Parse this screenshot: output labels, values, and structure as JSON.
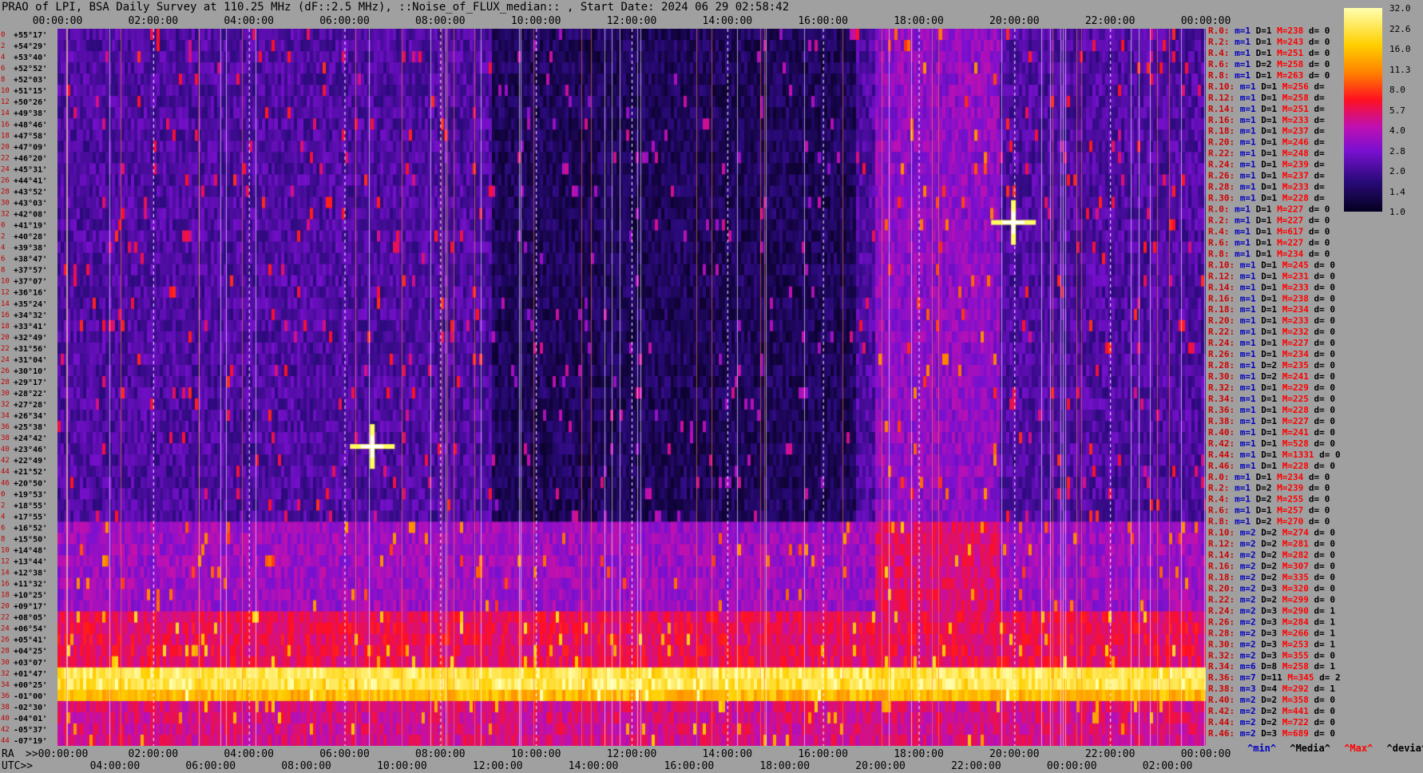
{
  "chart_data": {
    "type": "heatmap",
    "title": "PRAO of LPI, BSA Daily Survey at 110.25 MHz (dF::2.5 MHz), ::Noise_of_FLUX_median:: , Start Date: 2024 06 29 02:58:42",
    "x_top_ticks": [
      "00:00:00",
      "02:00:00",
      "04:00:00",
      "06:00:00",
      "08:00:00",
      "10:00:00",
      "12:00:00",
      "14:00:00",
      "16:00:00",
      "18:00:00",
      "20:00:00",
      "22:00:00",
      "00:00:00"
    ],
    "x_bottom_ra_ticks": [
      ">>00:00:00",
      "02:00:00",
      "04:00:00",
      "06:00:00",
      "08:00:00",
      "10:00:00",
      "12:00:00",
      "14:00:00",
      "16:00:00",
      "18:00:00",
      "20:00:00",
      "22:00:00",
      "00:00:00"
    ],
    "x_bottom_utc_ticks": [
      "04:00:00",
      "06:00:00",
      "08:00:00",
      "10:00:00",
      "12:00:00",
      "14:00:00",
      "16:00:00",
      "18:00:00",
      "20:00:00",
      "22:00:00",
      "00:00:00",
      "02:00:00"
    ],
    "ra_label": "RA",
    "utc_label": "UTC>>",
    "declinations": [
      "+55°17'",
      "+54°29'",
      "+53°40'",
      "+52°52'",
      "+52°03'",
      "+51°15'",
      "+50°26'",
      "+49°38'",
      "+48°46'",
      "+47°58'",
      "+47°09'",
      "+46°20'",
      "+45°31'",
      "+44°41'",
      "+43°52'",
      "+43°03'",
      "+42°08'",
      "+41°19'",
      "+40°28'",
      "+39°38'",
      "+38°47'",
      "+37°57'",
      "+37°07'",
      "+36°16'",
      "+35°24'",
      "+34°32'",
      "+33°41'",
      "+32°49'",
      "+31°56'",
      "+31°04'",
      "+30°10'",
      "+29°17'",
      "+28°22'",
      "+27°28'",
      "+26°34'",
      "+25°38'",
      "+24°42'",
      "+23°46'",
      "+22°49'",
      "+21°52'",
      "+20°50'",
      "+19°53'",
      "+18°55'",
      "+17°55'",
      "+16°52'",
      "+15°50'",
      "+14°48'",
      "+13°44'",
      "+12°38'",
      "+11°32'",
      "+10°25'",
      "+09°17'",
      "+08°05'",
      "+06°54'",
      "+05°41'",
      "+04°25'",
      "+03°07'",
      "+01°47'",
      "+00°25'",
      "-01°00'",
      "-02°30'",
      "-04°01'",
      "-05°37'",
      "-07°19'"
    ],
    "row_indices": [
      "0",
      "2",
      "4",
      "6",
      "8",
      "10",
      "12",
      "14",
      "16",
      "18",
      "20",
      "22",
      "24",
      "26",
      "28",
      "30",
      "32",
      "0",
      "2",
      "4",
      "6",
      "8",
      "10",
      "12",
      "14",
      "16",
      "18",
      "20",
      "22",
      "24",
      "26",
      "28",
      "30",
      "32",
      "34",
      "36",
      "38",
      "40",
      "42",
      "44",
      "46",
      "0",
      "2",
      "4",
      "6",
      "8",
      "10",
      "12",
      "14",
      "16",
      "18",
      "20",
      "22",
      "24",
      "26",
      "28",
      "30",
      "32",
      "34",
      "36",
      "38",
      "40",
      "42",
      "44"
    ],
    "colorbar": {
      "ticks": [
        "32.0",
        "22.6",
        "16.0",
        "11.3",
        "8.0",
        "5.7",
        "4.0",
        "2.8",
        "2.0",
        "1.4",
        "1.0"
      ],
      "range": [
        1.0,
        32.0
      ]
    },
    "bright_sources": [
      {
        "ra": "06:35",
        "dec": "+23°46'"
      },
      {
        "ra": "19:59",
        "dec": "+41°19'"
      }
    ],
    "row_stats": [
      {
        "r": "R.0:",
        "m": "m=1",
        "d": "D=1",
        "mx": "M=238",
        "dv": "d= 0"
      },
      {
        "r": "R.2:",
        "m": "m=1",
        "d": "D=1",
        "mx": "M=243",
        "dv": "d= 0"
      },
      {
        "r": "R.4:",
        "m": "m=1",
        "d": "D=1",
        "mx": "M=251",
        "dv": "d= 0"
      },
      {
        "r": "R.6:",
        "m": "m=1",
        "d": "D=2",
        "mx": "M=258",
        "dv": "d= 0"
      },
      {
        "r": "R.8:",
        "m": "m=1",
        "d": "D=1",
        "mx": "M=263",
        "dv": "d= 0"
      },
      {
        "r": "R.10:",
        "m": "m=1",
        "d": "D=1",
        "mx": "M=256",
        "dv": "d="
      },
      {
        "r": "R.12:",
        "m": "m=1",
        "d": "D=1",
        "mx": "M=258",
        "dv": "d="
      },
      {
        "r": "R.14:",
        "m": "m=1",
        "d": "D=1",
        "mx": "M=251",
        "dv": "d="
      },
      {
        "r": "R.16:",
        "m": "m=1",
        "d": "D=1",
        "mx": "M=233",
        "dv": "d="
      },
      {
        "r": "R.18:",
        "m": "m=1",
        "d": "D=1",
        "mx": "M=237",
        "dv": "d="
      },
      {
        "r": "R.20:",
        "m": "m=1",
        "d": "D=1",
        "mx": "M=246",
        "dv": "d="
      },
      {
        "r": "R.22:",
        "m": "m=1",
        "d": "D=1",
        "mx": "M=248",
        "dv": "d="
      },
      {
        "r": "R.24:",
        "m": "m=1",
        "d": "D=1",
        "mx": "M=239",
        "dv": "d="
      },
      {
        "r": "R.26:",
        "m": "m=1",
        "d": "D=1",
        "mx": "M=237",
        "dv": "d="
      },
      {
        "r": "R.28:",
        "m": "m=1",
        "d": "D=1",
        "mx": "M=233",
        "dv": "d="
      },
      {
        "r": "R.30:",
        "m": "m=1",
        "d": "D=1",
        "mx": "M=228",
        "dv": "d="
      },
      {
        "r": "R.0:",
        "m": "m=1",
        "d": "D=1",
        "mx": "M=227",
        "dv": "d= 0"
      },
      {
        "r": "R.2:",
        "m": "m=1",
        "d": "D=1",
        "mx": "M=227",
        "dv": "d= 0"
      },
      {
        "r": "R.4:",
        "m": "m=1",
        "d": "D=1",
        "mx": "M=617",
        "dv": "d= 0"
      },
      {
        "r": "R.6:",
        "m": "m=1",
        "d": "D=1",
        "mx": "M=227",
        "dv": "d= 0"
      },
      {
        "r": "R.8:",
        "m": "m=1",
        "d": "D=1",
        "mx": "M=234",
        "dv": "d= 0"
      },
      {
        "r": "R.10:",
        "m": "m=1",
        "d": "D=1",
        "mx": "M=245",
        "dv": "d= 0"
      },
      {
        "r": "R.12:",
        "m": "m=1",
        "d": "D=1",
        "mx": "M=231",
        "dv": "d= 0"
      },
      {
        "r": "R.14:",
        "m": "m=1",
        "d": "D=1",
        "mx": "M=233",
        "dv": "d= 0"
      },
      {
        "r": "R.16:",
        "m": "m=1",
        "d": "D=1",
        "mx": "M=238",
        "dv": "d= 0"
      },
      {
        "r": "R.18:",
        "m": "m=1",
        "d": "D=1",
        "mx": "M=234",
        "dv": "d= 0"
      },
      {
        "r": "R.20:",
        "m": "m=1",
        "d": "D=1",
        "mx": "M=233",
        "dv": "d= 0"
      },
      {
        "r": "R.22:",
        "m": "m=1",
        "d": "D=1",
        "mx": "M=232",
        "dv": "d= 0"
      },
      {
        "r": "R.24:",
        "m": "m=1",
        "d": "D=1",
        "mx": "M=227",
        "dv": "d= 0"
      },
      {
        "r": "R.26:",
        "m": "m=1",
        "d": "D=1",
        "mx": "M=234",
        "dv": "d= 0"
      },
      {
        "r": "R.28:",
        "m": "m=1",
        "d": "D=2",
        "mx": "M=235",
        "dv": "d= 0"
      },
      {
        "r": "R.30:",
        "m": "m=1",
        "d": "D=2",
        "mx": "M=241",
        "dv": "d= 0"
      },
      {
        "r": "R.32:",
        "m": "m=1",
        "d": "D=1",
        "mx": "M=229",
        "dv": "d= 0"
      },
      {
        "r": "R.34:",
        "m": "m=1",
        "d": "D=1",
        "mx": "M=225",
        "dv": "d= 0"
      },
      {
        "r": "R.36:",
        "m": "m=1",
        "d": "D=1",
        "mx": "M=228",
        "dv": "d= 0"
      },
      {
        "r": "R.38:",
        "m": "m=1",
        "d": "D=1",
        "mx": "M=227",
        "dv": "d= 0"
      },
      {
        "r": "R.40:",
        "m": "m=1",
        "d": "D=1",
        "mx": "M=241",
        "dv": "d= 0"
      },
      {
        "r": "R.42:",
        "m": "m=1",
        "d": "D=1",
        "mx": "M=528",
        "dv": "d= 0"
      },
      {
        "r": "R.44:",
        "m": "m=1",
        "d": "D=1",
        "mx": "M=1331",
        "dv": "d= 0"
      },
      {
        "r": "R.46:",
        "m": "m=1",
        "d": "D=1",
        "mx": "M=228",
        "dv": "d= 0"
      },
      {
        "r": "R.0:",
        "m": "m=1",
        "d": "D=1",
        "mx": "M=234",
        "dv": "d= 0"
      },
      {
        "r": "R.2:",
        "m": "m=1",
        "d": "D=2",
        "mx": "M=239",
        "dv": "d= 0"
      },
      {
        "r": "R.4:",
        "m": "m=1",
        "d": "D=2",
        "mx": "M=255",
        "dv": "d= 0"
      },
      {
        "r": "R.6:",
        "m": "m=1",
        "d": "D=1",
        "mx": "M=257",
        "dv": "d= 0"
      },
      {
        "r": "R.8:",
        "m": "m=1",
        "d": "D=2",
        "mx": "M=270",
        "dv": "d= 0"
      },
      {
        "r": "R.10:",
        "m": "m=2",
        "d": "D=2",
        "mx": "M=274",
        "dv": "d= 0"
      },
      {
        "r": "R.12:",
        "m": "m=2",
        "d": "D=2",
        "mx": "M=281",
        "dv": "d= 0"
      },
      {
        "r": "R.14:",
        "m": "m=2",
        "d": "D=2",
        "mx": "M=282",
        "dv": "d= 0"
      },
      {
        "r": "R.16:",
        "m": "m=2",
        "d": "D=2",
        "mx": "M=307",
        "dv": "d= 0"
      },
      {
        "r": "R.18:",
        "m": "m=2",
        "d": "D=2",
        "mx": "M=335",
        "dv": "d= 0"
      },
      {
        "r": "R.20:",
        "m": "m=2",
        "d": "D=3",
        "mx": "M=320",
        "dv": "d= 0"
      },
      {
        "r": "R.22:",
        "m": "m=2",
        "d": "D=2",
        "mx": "M=299",
        "dv": "d= 0"
      },
      {
        "r": "R.24:",
        "m": "m=2",
        "d": "D=3",
        "mx": "M=290",
        "dv": "d= 1"
      },
      {
        "r": "R.26:",
        "m": "m=2",
        "d": "D=3",
        "mx": "M=284",
        "dv": "d= 1"
      },
      {
        "r": "R.28:",
        "m": "m=2",
        "d": "D=3",
        "mx": "M=266",
        "dv": "d= 1"
      },
      {
        "r": "R.30:",
        "m": "m=2",
        "d": "D=3",
        "mx": "M=253",
        "dv": "d= 1"
      },
      {
        "r": "R.32:",
        "m": "m=2",
        "d": "D=3",
        "mx": "M=355",
        "dv": "d= 0"
      },
      {
        "r": "R.34:",
        "m": "m=6",
        "d": "D=8",
        "mx": "M=258",
        "dv": "d= 1"
      },
      {
        "r": "R.36:",
        "m": "m=7",
        "d": "D=11",
        "mx": "M=345",
        "dv": "d= 2"
      },
      {
        "r": "R.38:",
        "m": "m=3",
        "d": "D=4",
        "mx": "M=292",
        "dv": "d= 1"
      },
      {
        "r": "R.40:",
        "m": "m=2",
        "d": "D=2",
        "mx": "M=358",
        "dv": "d= 0"
      },
      {
        "r": "R.42:",
        "m": "m=2",
        "d": "D=2",
        "mx": "M=441",
        "dv": "d= 0"
      },
      {
        "r": "R.44:",
        "m": "m=2",
        "d": "D=2",
        "mx": "M=722",
        "dv": "d= 0"
      },
      {
        "r": "R.46:",
        "m": "m=2",
        "d": "D=3",
        "mx": "M=689",
        "dv": "d= 0"
      }
    ],
    "legend": {
      "min": "^min^",
      "median": "^Media^",
      "max": "^Max^",
      "dev": "^devia^"
    },
    "stat_colors": {
      "row": "#d00000",
      "min": "#0000c0",
      "median": "#000000",
      "max": "#ff0000",
      "dev": "#000000"
    }
  }
}
